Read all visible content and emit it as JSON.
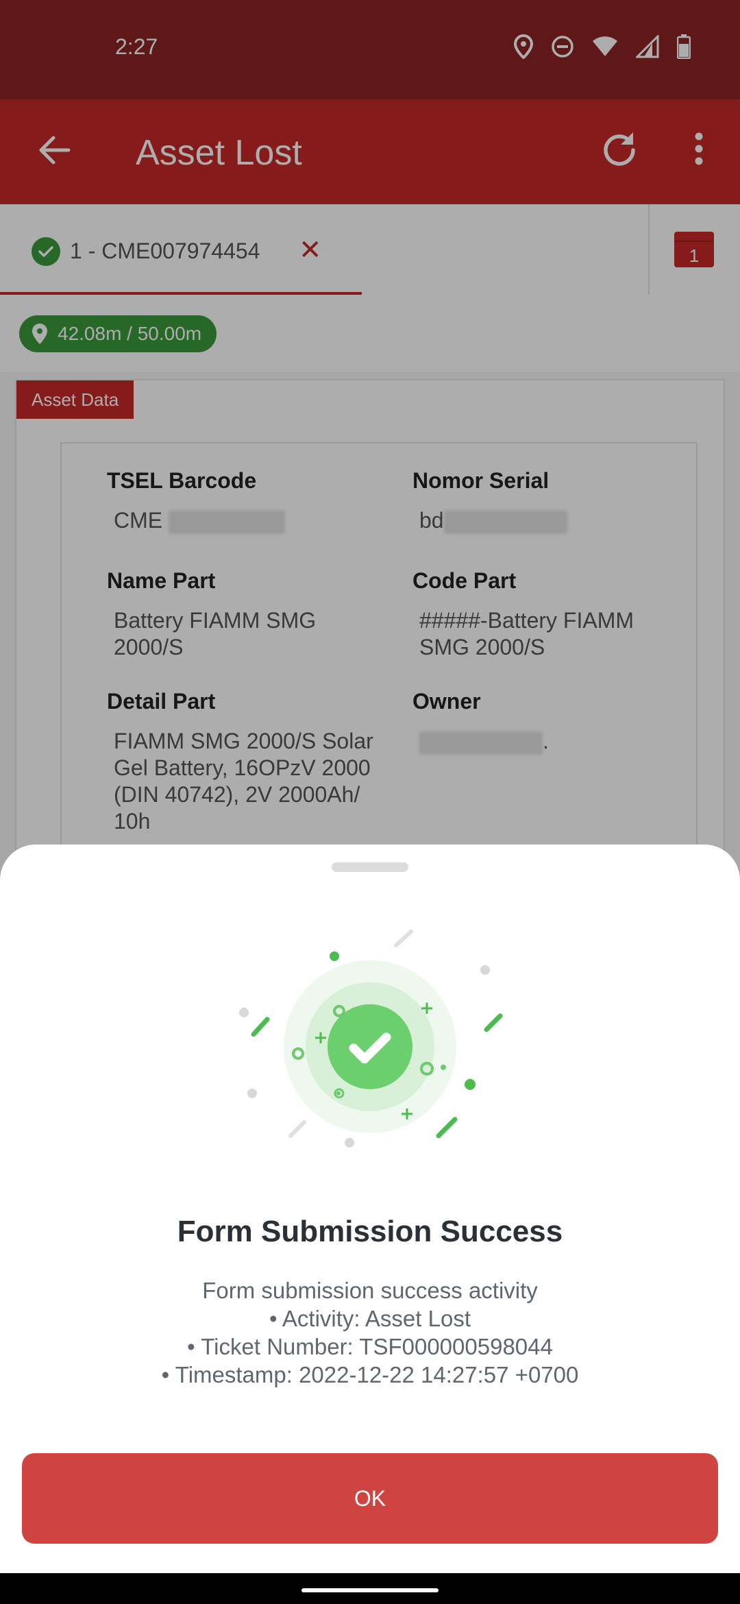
{
  "status_bar": {
    "time": "2:27"
  },
  "app_bar": {
    "title": "Asset Lost"
  },
  "tab": {
    "label": "1 - CME007974454",
    "close": "✕",
    "calendar_count": "1"
  },
  "distance": "42.08m / 50.00m",
  "section_tag": "Asset Data",
  "fields": {
    "tsel_barcode": {
      "label": "TSEL Barcode",
      "value": "CME"
    },
    "nomor_serial": {
      "label": "Nomor Serial",
      "value": "bd"
    },
    "name_part": {
      "label": "Name Part",
      "value": "Battery FIAMM SMG 2000/S"
    },
    "code_part": {
      "label": "Code Part",
      "value": "#####-Battery FIAMM SMG 2000/S"
    },
    "detail_part": {
      "label": "Detail Part",
      "value": "FIAMM SMG 2000/S Solar Gel Battery, 16OPzV 2000 (DIN 40742), 2V 2000Ah/ 10h"
    },
    "owner": {
      "label": "Owner",
      "value": "."
    }
  },
  "dialog": {
    "title": "Form Submission Success",
    "line1": "Form submission success activity",
    "line2": "• Activity: Asset Lost",
    "line3": "• Ticket Number: TSF000000598044",
    "line4": "• Timestamp: 2022-12-22 14:27:57 +0700",
    "ok_label": "OK"
  },
  "colors": {
    "status_bar": "#8b2424",
    "app_bar": "#c62828",
    "success_green": "#3a9a3d",
    "ok_button": "#cf4440"
  },
  "icons": [
    "back-arrow-icon",
    "refresh-icon",
    "more-vert-icon",
    "check-circle-icon",
    "calendar-icon",
    "location-pin-icon",
    "success-check-icon"
  ]
}
